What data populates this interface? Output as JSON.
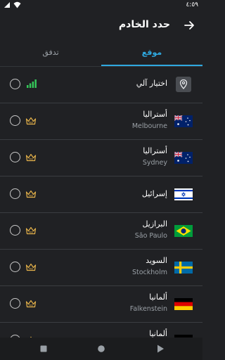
{
  "status": {
    "time": "٤:٥٩"
  },
  "header": {
    "title": "حدد الخادم"
  },
  "tabs": [
    {
      "label": "موقع"
    },
    {
      "label": "تدفق"
    }
  ],
  "auto": {
    "label": "اختيار آلي"
  },
  "servers": [
    {
      "country": "أستراليا",
      "city": "Melbourne",
      "flag": "australia"
    },
    {
      "country": "أستراليا",
      "city": "Sydney",
      "flag": "australia"
    },
    {
      "country": "إسرائيل",
      "city": "",
      "flag": "israel"
    },
    {
      "country": "البرازيل",
      "city": "São Paulo",
      "flag": "brazil"
    },
    {
      "country": "السويد",
      "city": "Stockholm",
      "flag": "sweden"
    },
    {
      "country": "ألمانيا",
      "city": "Falkenstein",
      "flag": "germany"
    },
    {
      "country": "ألمانيا",
      "city": "",
      "flag": "germany"
    }
  ],
  "colors": {
    "accent": "#2fa9e0",
    "signal": "#34c759",
    "pro": "#e2b04a",
    "bg": "#202124"
  }
}
